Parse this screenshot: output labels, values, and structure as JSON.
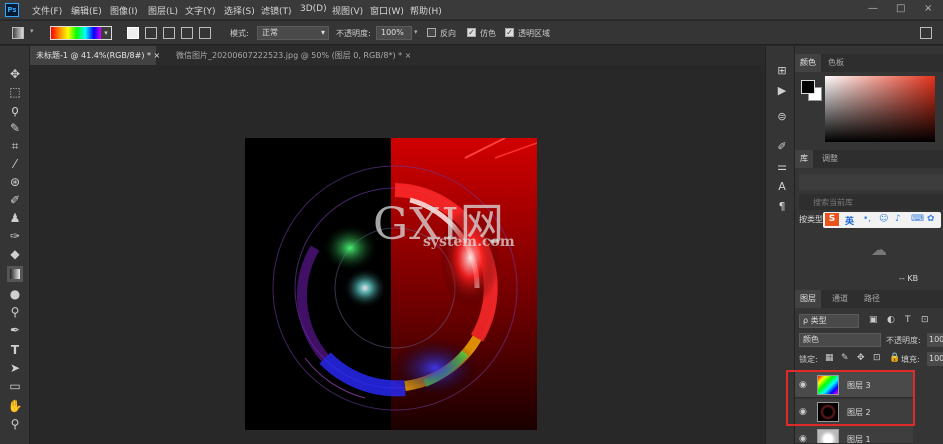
{
  "app": {
    "logo": "Ps"
  },
  "menu": [
    "文件(F)",
    "编辑(E)",
    "图像(I)",
    "图层(L)",
    "文字(Y)",
    "选择(S)",
    "滤镜(T)",
    "3D(D)",
    "视图(V)",
    "窗口(W)",
    "帮助(H)"
  ],
  "window_controls": {
    "minimize": "—",
    "restore": "□",
    "close": "×"
  },
  "options": {
    "mode_label": "模式:",
    "mode_value": "正常",
    "opacity_label": "不透明度:",
    "opacity_value": "100%",
    "reverse_label": "反向",
    "dither_label": "仿色",
    "transparency_label": "透明区域"
  },
  "tabs": [
    {
      "label": "未标题-1 @ 41.4%(RGB/8#) *",
      "close": "×"
    },
    {
      "label": "微信图片_20200607222523.jpg @ 50% (图层 0, RGB/8*) *",
      "close": "×"
    }
  ],
  "panels": {
    "color_tabs": [
      "颜色",
      "色板"
    ],
    "library_tabs": [
      "库",
      "调整"
    ],
    "library_search_placeholder": "搜索当前库",
    "library_size": "-- KB",
    "ime": {
      "logo": "S",
      "label": "英"
    },
    "search_type": "按类型",
    "layers_tabs": [
      "图层",
      "通道",
      "路径"
    ],
    "filter_kind": "ρ 类型",
    "blend_mode": "颜色",
    "opacity_label": "不透明度:",
    "opacity_value": "100%",
    "lock_label": "锁定:",
    "fill_label": "填充:",
    "fill_value": "100%"
  },
  "layers": [
    {
      "name": "图层 3",
      "visible": true,
      "thumb": "gradient"
    },
    {
      "name": "图层 2",
      "visible": true,
      "thumb": "dark-ring"
    },
    {
      "name": "图层 1",
      "visible": true,
      "thumb": "ring"
    }
  ],
  "watermark": {
    "big": "GXI网",
    "small": "system.com"
  },
  "icons": {
    "tools": [
      "move-icon",
      "marquee-icon",
      "lasso-icon",
      "quick-select-icon",
      "crop-icon",
      "eyedropper-icon",
      "healing-icon",
      "brush-icon",
      "stamp-icon",
      "history-brush-icon",
      "eraser-icon",
      "gradient-icon",
      "blur-icon",
      "dodge-icon",
      "pen-icon",
      "type-icon",
      "path-select-icon",
      "rectangle-icon",
      "hand-icon",
      "zoom-icon"
    ]
  },
  "colors": {
    "accent": "#31a8ff",
    "highlight": "#e02a2a"
  }
}
